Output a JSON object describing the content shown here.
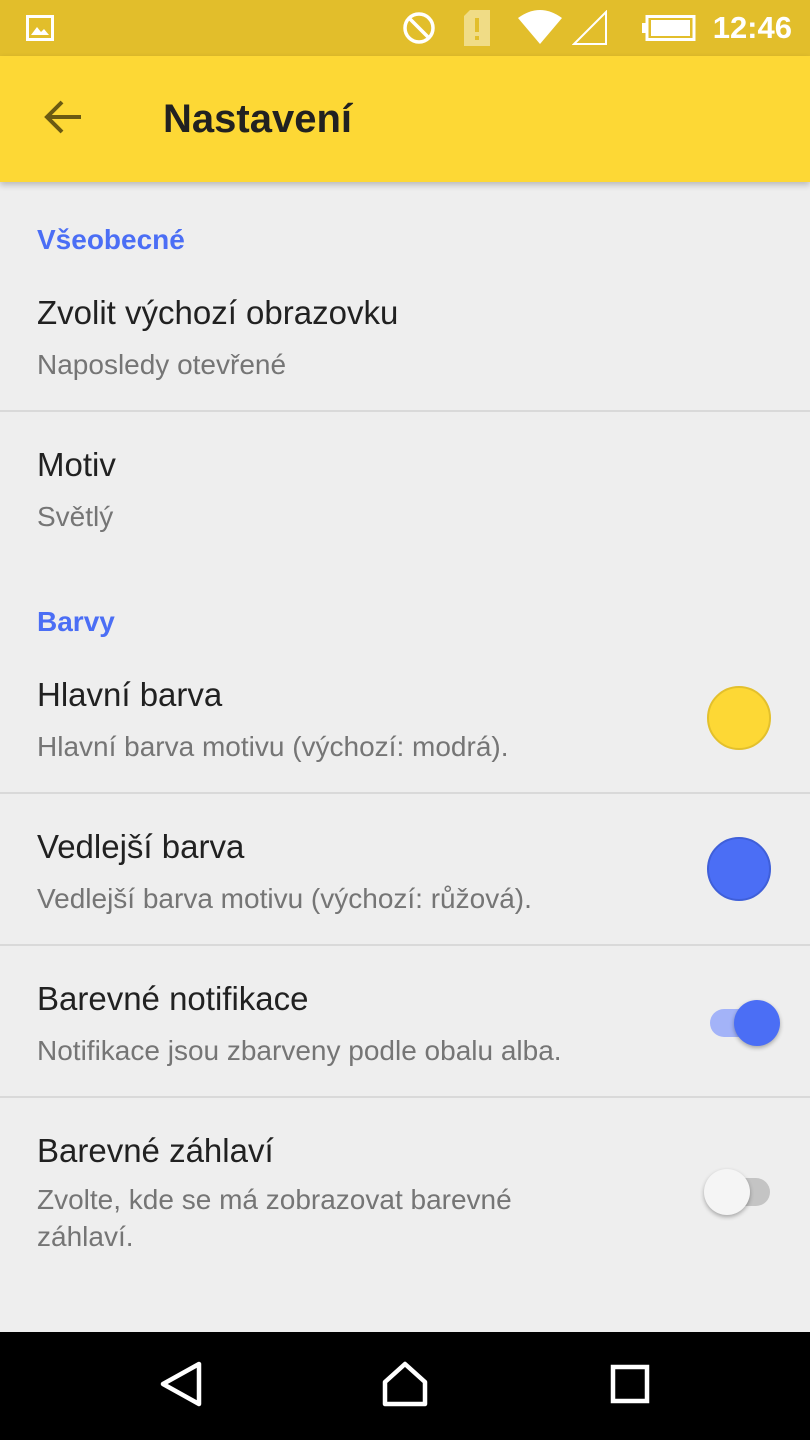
{
  "status_bar": {
    "time": "12:46",
    "icons": [
      "image-icon",
      "do-not-disturb-icon",
      "sim-alert-icon",
      "wifi-icon",
      "cell-signal-icon",
      "battery-icon"
    ]
  },
  "app_bar": {
    "title": "Nastavení",
    "back_icon": "arrow-back-icon"
  },
  "sections": {
    "general": {
      "header": "Všeobecné",
      "items": [
        {
          "title": "Zvolit výchozí obrazovku",
          "summary": "Naposledy otevřené"
        },
        {
          "title": "Motiv",
          "summary": "Světlý"
        }
      ]
    },
    "colors": {
      "header": "Barvy",
      "items": [
        {
          "title": "Hlavní barva",
          "summary": "Hlavní barva motivu (výchozí: modrá).",
          "color": "#fdd835"
        },
        {
          "title": "Vedlejší barva",
          "summary": "Vedlejší barva motivu (výchozí: růžová).",
          "color": "#4b6ef5"
        },
        {
          "title": "Barevné notifikace",
          "summary": "Notifikace jsou zbarveny podle obalu alba.",
          "checked": true
        },
        {
          "title": "Barevné záhlaví",
          "summary": "Zvolte, kde se má zobrazovat barevné záhlaví.",
          "checked": false
        }
      ]
    }
  },
  "nav_bar": {
    "buttons": [
      "back-triangle-icon",
      "home-icon",
      "recents-square-icon"
    ]
  },
  "colors": {
    "status_bar": "#e2be2b",
    "app_bar": "#fdd835",
    "accent": "#4b6ef5",
    "background": "#eeeeee"
  }
}
